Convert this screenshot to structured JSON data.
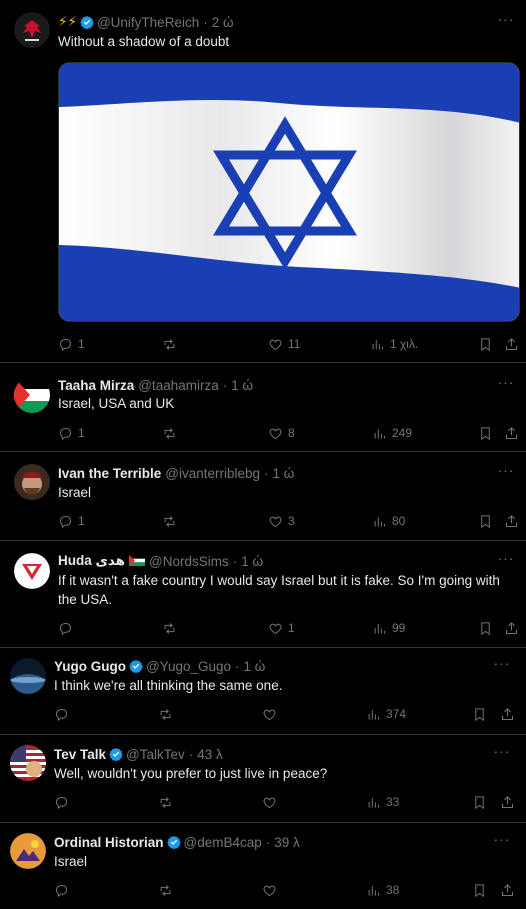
{
  "tweets": [
    {
      "prefix_icons": "⚡⚡",
      "name": "",
      "handle": "@UnifyTheReich",
      "time": "2 ώ",
      "text": "Without a shadow of a doubt",
      "replies": "1",
      "retweets": "",
      "likes": "11",
      "views": "1 χιλ.",
      "verified": true
    },
    {
      "name": "Taaha Mirza",
      "handle": "@taahamirza",
      "time": "1 ώ",
      "text": "Israel, USA and UK",
      "replies": "1",
      "retweets": "",
      "likes": "8",
      "views": "249",
      "verified": false
    },
    {
      "name": "Ivan the Terrible",
      "handle": "@ivanterriblebg",
      "time": "1 ώ",
      "text": "Israel",
      "replies": "1",
      "retweets": "",
      "likes": "3",
      "views": "80",
      "verified": false
    },
    {
      "name": "Huda هدى",
      "flag": "🇵🇸",
      "handle": "@NordsSims",
      "time": "1 ώ",
      "text": "If it wasn't a fake country I would say Israel but it is fake. So I'm going with the USA.",
      "replies": "",
      "retweets": "",
      "likes": "1",
      "views": "99",
      "verified": false
    },
    {
      "name": "Yugo Gugo",
      "handle": "@Yugo_Gugo",
      "time": "1 ώ",
      "text": "I think we're all thinking the same one.",
      "replies": "",
      "retweets": "",
      "likes": "",
      "views": "374",
      "verified": true
    },
    {
      "name": "Tev Talk",
      "handle": "@TalkTev",
      "time": "43 λ",
      "text": "Well, wouldn't you prefer to just live in peace?",
      "replies": "",
      "retweets": "",
      "likes": "",
      "views": "33",
      "verified": true
    },
    {
      "name": "Ordinal Historian",
      "handle": "@demB4cap",
      "time": "39 λ",
      "text": "Israel",
      "replies": "",
      "retweets": "",
      "likes": "",
      "views": "38",
      "verified": true
    }
  ],
  "colors": {
    "background": "#000000",
    "text": "#e7e9ea",
    "muted": "#71767b",
    "border": "#2f3336",
    "verified_blue": "#1d9bf0",
    "israel_blue": "#1a3fb5"
  },
  "icons": [
    "reply-icon",
    "retweet-icon",
    "like-icon",
    "views-icon",
    "bookmark-icon",
    "share-icon",
    "more-icon",
    "verified-badge-icon"
  ]
}
